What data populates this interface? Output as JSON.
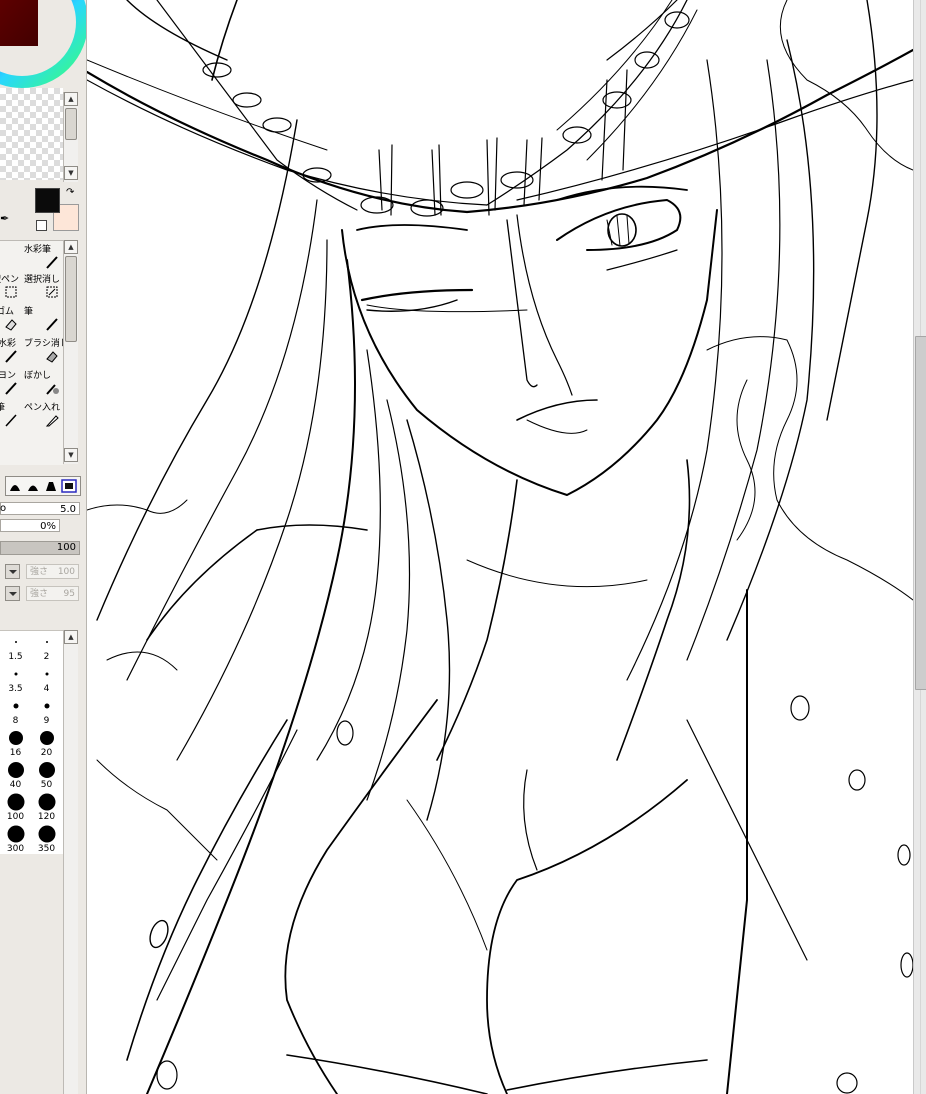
{
  "tools": {
    "row1": [
      "水彩筆"
    ],
    "row2": [
      "択ペン",
      "選択消し"
    ],
    "row3": [
      "ゴム",
      "筆"
    ],
    "row4": [
      "水彩",
      "ブラシ消し"
    ],
    "row5": [
      "ヨン",
      "ぼかし"
    ],
    "row6": [
      "筆",
      "ペン入れ"
    ]
  },
  "brush_settings": {
    "size_value": "5.0",
    "min_size_value": "0%",
    "density_value": "100",
    "blend_label": "強さ",
    "blend_value": "100",
    "texture_label": "強さ",
    "texture_value": "95"
  },
  "brush_sizes": [
    "1.5",
    "2",
    "3.5",
    "4",
    "8",
    "9",
    "16",
    "20",
    "40",
    "50",
    "100",
    "120",
    "300",
    "350"
  ],
  "colors": {
    "main": "#0b0b0b",
    "sub": "#fde6d8",
    "selected_tip_border": "#2a2abf"
  }
}
